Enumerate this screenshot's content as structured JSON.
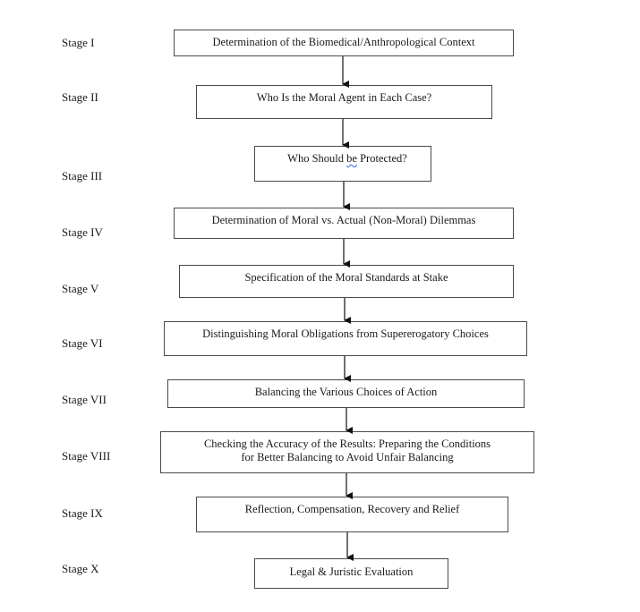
{
  "flowchart": {
    "stages": [
      {
        "label": "Stage I",
        "text": "Determination of the Biomedical/Anthropological Context"
      },
      {
        "label": "Stage II",
        "text": "Who Is the Moral Agent in Each Case?"
      },
      {
        "label": "Stage III",
        "text_parts": [
          "Who Should ",
          "be",
          " Protected?"
        ]
      },
      {
        "label": "Stage IV",
        "text": "Determination of Moral vs. Actual (Non-Moral) Dilemmas"
      },
      {
        "label": "Stage V",
        "text": "Specification of the Moral Standards at Stake"
      },
      {
        "label": "Stage VI",
        "text": "Distinguishing Moral Obligations from Supererogatory Choices"
      },
      {
        "label": "Stage VII",
        "text": "Balancing the Various Choices of Action"
      },
      {
        "label": "Stage VIII",
        "text_lines": [
          "Checking the Accuracy of the Results: Preparing the Conditions",
          "for Better Balancing to Avoid Unfair Balancing"
        ]
      },
      {
        "label": "Stage IX",
        "text": "Reflection, Compensation, Recovery and Relief"
      },
      {
        "label": "Stage X",
        "text": "Legal & Juristic Evaluation"
      }
    ]
  }
}
